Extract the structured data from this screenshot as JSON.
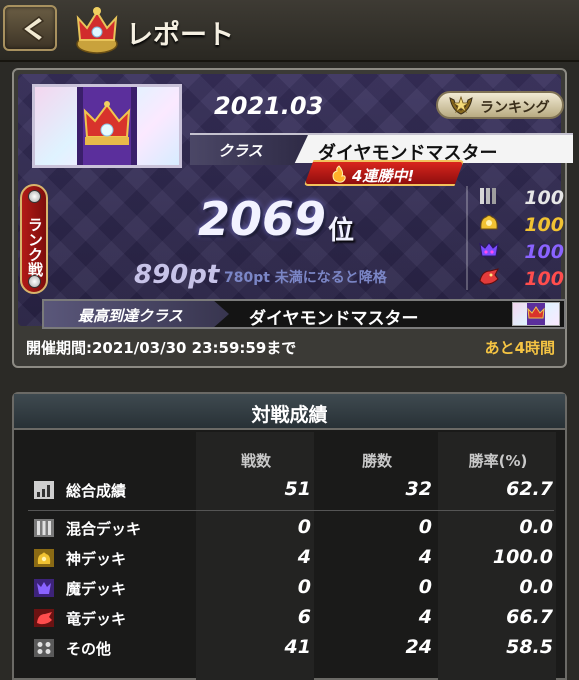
{
  "header": {
    "title": "レポート",
    "back_icon": "chevron-left-icon",
    "title_icon": "crown-icon"
  },
  "report": {
    "season": "2021.03",
    "ranking_label": "ランキング",
    "class_label": "クラス",
    "class_value": "ダイヤモンドマスター",
    "streak": "4連勝中!",
    "rank_tab_label": "ランク戦",
    "rank": "2069",
    "rank_suffix": "位",
    "points": "890pt",
    "demotion_note": "780pt 未満になると降格",
    "deck_stats": [
      {
        "icon": "mixed-deck-icon",
        "value": "100",
        "color": "#e6e6e6"
      },
      {
        "icon": "god-deck-icon",
        "value": "100",
        "color": "#f1c232"
      },
      {
        "icon": "demon-deck-icon",
        "value": "100",
        "color": "#8a63ff"
      },
      {
        "icon": "dragon-deck-icon",
        "value": "100",
        "color": "#ff4d4d"
      }
    ],
    "best_class_label": "最高到達クラス",
    "best_class_value": "ダイヤモンドマスター",
    "period": "開催期間:2021/03/30 23:59:59まで",
    "remaining": "あと4時間"
  },
  "record": {
    "title": "対戦成績",
    "columns": [
      "戦数",
      "勝数",
      "勝率(%)"
    ],
    "rows": [
      {
        "icon": "overall-stats-icon",
        "label": "総合成績",
        "battles": "51",
        "wins": "32",
        "rate": "62.7"
      },
      {
        "icon": "mixed-deck-icon",
        "label": "混合デッキ",
        "battles": "0",
        "wins": "0",
        "rate": "0.0"
      },
      {
        "icon": "god-deck-icon",
        "label": "神デッキ",
        "battles": "4",
        "wins": "4",
        "rate": "100.0"
      },
      {
        "icon": "demon-deck-icon",
        "label": "魔デッキ",
        "battles": "0",
        "wins": "0",
        "rate": "0.0"
      },
      {
        "icon": "dragon-deck-icon",
        "label": "竜デッキ",
        "battles": "6",
        "wins": "4",
        "rate": "66.7"
      },
      {
        "icon": "other-deck-icon",
        "label": "その他",
        "battles": "41",
        "wins": "24",
        "rate": "58.5"
      }
    ]
  }
}
